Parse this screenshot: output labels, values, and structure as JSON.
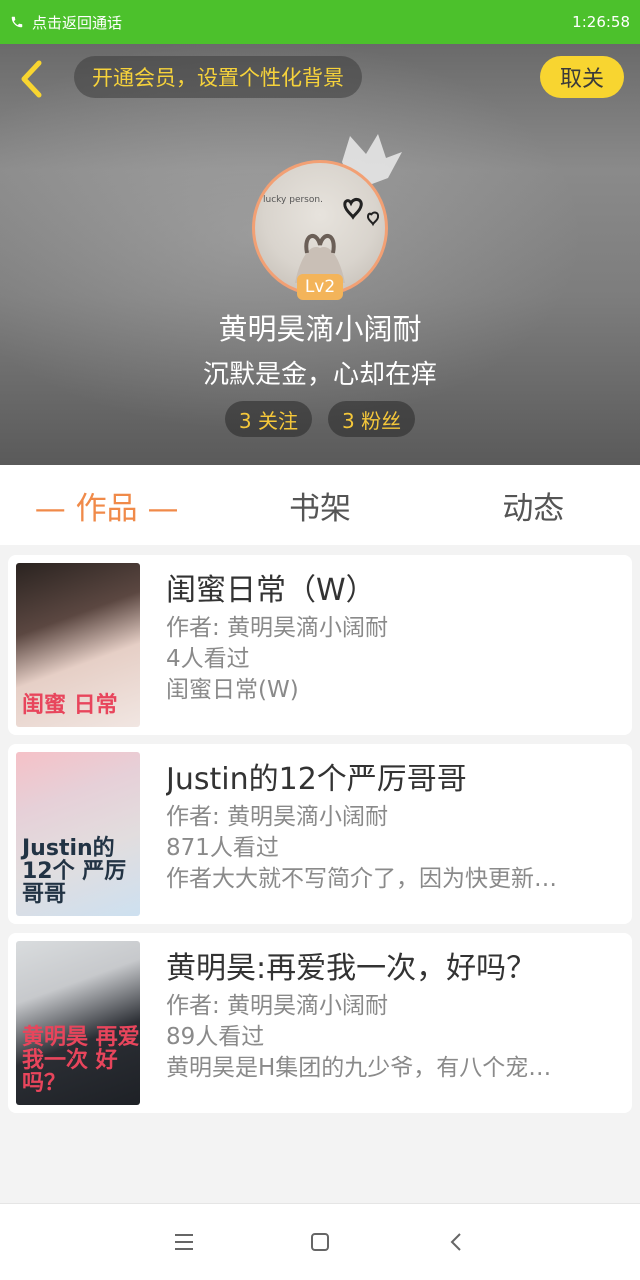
{
  "status": {
    "left_text": "点击返回通话",
    "time": "1:26:58",
    "bar_color": "#4cc12c"
  },
  "header": {
    "promo": "开通会员，设置个性化背景",
    "unfollow": "取关",
    "avatar_text": "lucky person.",
    "level": "Lv2",
    "username": "黄明昊滴小阔耐",
    "bio": "沉默是金，心却在痒",
    "following": "3 关注",
    "followers": "3 粉丝"
  },
  "tabs": [
    {
      "label": "— 作品 —",
      "active": true
    },
    {
      "label": "书架",
      "active": false
    },
    {
      "label": "动态",
      "active": false
    }
  ],
  "works": [
    {
      "title": "闺蜜日常（W）",
      "author": "作者: 黄明昊滴小阔耐",
      "views": "4人看过",
      "desc": "闺蜜日常(W)",
      "cover_text": "闺蜜 日常"
    },
    {
      "title": "Justin的12个严厉哥哥",
      "author": "作者: 黄明昊滴小阔耐",
      "views": "871人看过",
      "desc": "作者大大就不写简介了，因为快更新…",
      "cover_text": "Justin的 12个 严厉哥哥"
    },
    {
      "title": "黄明昊:再爱我一次，好吗？",
      "author": "作者: 黄明昊滴小阔耐",
      "views": "89人看过",
      "desc": "黄明昊是H集团的九少爷，有八个宠…",
      "cover_text": "黄明昊 再爱我一次 好吗？"
    }
  ],
  "colors": {
    "accent": "#f08a49",
    "yellow": "#f8d530"
  }
}
